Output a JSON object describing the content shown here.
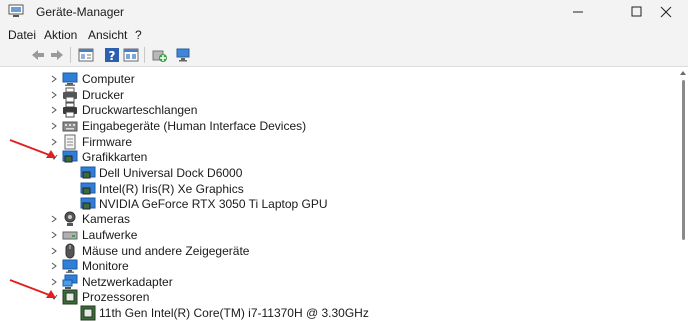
{
  "window": {
    "title": "Geräte-Manager"
  },
  "menu": [
    "Datei",
    "Aktion",
    "Ansicht",
    "?"
  ],
  "toolbar": {
    "icons": [
      "back-icon",
      "forward-icon",
      "properties-icon",
      "help-icon",
      "view-icon",
      "update-driver-icon",
      "scan-hardware-icon"
    ]
  },
  "tree": {
    "computer": "Computer",
    "printers": "Drucker",
    "print_queues": "Druckwarteschlangen",
    "hid": "Eingabegeräte (Human Interface Devices)",
    "firmware": "Firmware",
    "display_adapters": {
      "label": "Grafikkarten",
      "children": [
        "Dell Universal Dock D6000",
        "Intel(R) Iris(R) Xe Graphics",
        "NVIDIA GeForce RTX 3050 Ti Laptop GPU"
      ]
    },
    "cameras": "Kameras",
    "drives": "Laufwerke",
    "mice": "Mäuse und andere Zeigegeräte",
    "monitors": "Monitore",
    "network": "Netzwerkadapter",
    "processors": {
      "label": "Prozessoren",
      "children": [
        "11th Gen Intel(R) Core(TM) i7-11370H @ 3.30GHz"
      ]
    }
  },
  "colors": {
    "annotation_arrow": "#e02020",
    "monitor_blue": "#2f7fd6",
    "chip_green": "#3d6b3a"
  }
}
